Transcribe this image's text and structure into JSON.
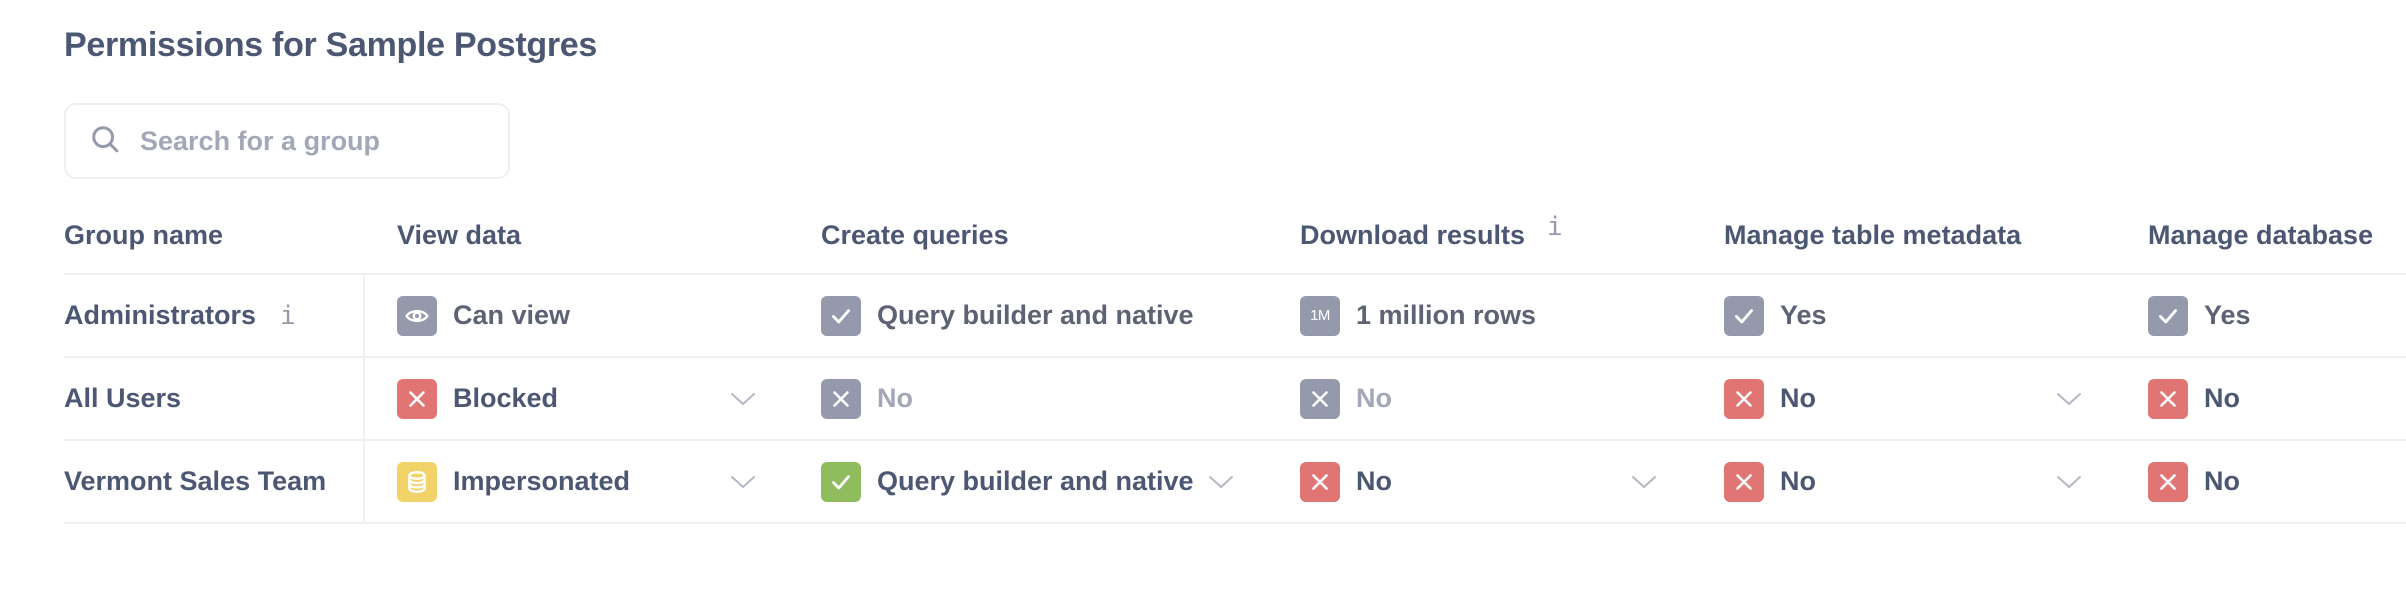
{
  "page": {
    "title": "Permissions for Sample Postgres"
  },
  "search": {
    "placeholder": "Search for a group",
    "value": "",
    "icon": "search-icon"
  },
  "colors": {
    "text_primary": "#4c5773",
    "text_muted": "#a3a8b8",
    "badge_gray": "#949aab",
    "badge_red": "#e07574",
    "badge_green": "#8fbc5d",
    "badge_yellow": "#f2d36a",
    "border": "#f0f0f2"
  },
  "table": {
    "columns": [
      {
        "label": "Group name",
        "info": false
      },
      {
        "label": "View data",
        "info": false
      },
      {
        "label": "Create queries",
        "info": false
      },
      {
        "label": "Download results",
        "info": true
      },
      {
        "label": "Manage table metadata",
        "info": false
      },
      {
        "label": "Manage database",
        "info": false
      }
    ],
    "info_glyph": "i",
    "rows": [
      {
        "group": "Administrators",
        "info": true,
        "cells": [
          {
            "value": "Can view",
            "icon": "eye-icon",
            "color": "gray",
            "text": "mid",
            "dropdown": false
          },
          {
            "value": "Query builder and native",
            "icon": "check-icon",
            "color": "gray",
            "text": "mid",
            "dropdown": false
          },
          {
            "value": "1 million rows",
            "icon": "one-million-icon",
            "icon_text": "1M",
            "color": "gray",
            "text": "mid",
            "dropdown": false
          },
          {
            "value": "Yes",
            "icon": "check-icon",
            "color": "gray",
            "text": "mid",
            "dropdown": false
          },
          {
            "value": "Yes",
            "icon": "check-icon",
            "color": "gray",
            "text": "mid",
            "dropdown": false
          }
        ]
      },
      {
        "group": "All Users",
        "info": false,
        "cells": [
          {
            "value": "Blocked",
            "icon": "close-icon",
            "color": "red",
            "text": "dark",
            "dropdown": true
          },
          {
            "value": "No",
            "icon": "close-icon",
            "color": "gray",
            "text": "light",
            "dropdown": false
          },
          {
            "value": "No",
            "icon": "close-icon",
            "color": "gray",
            "text": "light",
            "dropdown": false
          },
          {
            "value": "No",
            "icon": "close-icon",
            "color": "red",
            "text": "dark",
            "dropdown": true
          },
          {
            "value": "No",
            "icon": "close-icon",
            "color": "red",
            "text": "dark",
            "dropdown": false
          }
        ]
      },
      {
        "group": "Vermont Sales Team",
        "info": false,
        "cells": [
          {
            "value": "Impersonated",
            "icon": "database-icon",
            "color": "yellow",
            "text": "dark",
            "dropdown": true
          },
          {
            "value": "Query builder and native",
            "icon": "check-icon",
            "color": "green",
            "text": "dark",
            "dropdown": true
          },
          {
            "value": "No",
            "icon": "close-icon",
            "color": "red",
            "text": "dark",
            "dropdown": true
          },
          {
            "value": "No",
            "icon": "close-icon",
            "color": "red",
            "text": "dark",
            "dropdown": true
          },
          {
            "value": "No",
            "icon": "close-icon",
            "color": "red",
            "text": "dark",
            "dropdown": false
          }
        ]
      }
    ]
  }
}
